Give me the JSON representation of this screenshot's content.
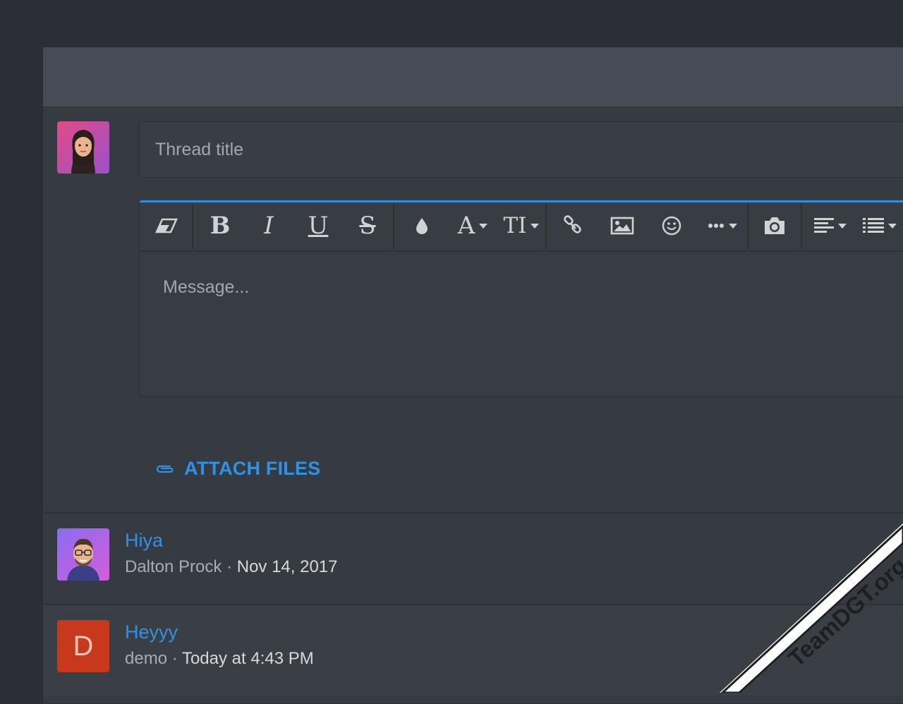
{
  "compose": {
    "title_placeholder": "Thread title",
    "message_placeholder": "Message...",
    "attach_label": "ATTACH FILES"
  },
  "toolbar": {
    "buttons": [
      {
        "name": "remove-formatting",
        "icon": "eraser-icon"
      },
      {
        "name": "bold",
        "glyph": "B"
      },
      {
        "name": "italic",
        "glyph": "I"
      },
      {
        "name": "underline",
        "glyph": "U"
      },
      {
        "name": "strikethrough",
        "glyph": "S"
      },
      {
        "name": "text-color",
        "icon": "droplet-icon"
      },
      {
        "name": "font-family",
        "glyph": "A"
      },
      {
        "name": "font-size",
        "glyph": "TI"
      },
      {
        "name": "insert-link",
        "icon": "link-icon"
      },
      {
        "name": "insert-image",
        "icon": "image-icon"
      },
      {
        "name": "smilies",
        "icon": "smiley-icon"
      },
      {
        "name": "more-options",
        "icon": "ellipsis-icon"
      },
      {
        "name": "insert-media",
        "icon": "camera-icon"
      },
      {
        "name": "alignment",
        "icon": "align-left-icon"
      },
      {
        "name": "list",
        "icon": "list-icon"
      }
    ]
  },
  "threads": [
    {
      "title": "Hiya",
      "author": "Dalton Prock",
      "separator": "·",
      "date": "Nov 14, 2017"
    },
    {
      "title": "Heyyy",
      "author": "demo",
      "separator": "·",
      "date": "Today at 4:43 PM",
      "avatar_letter": "D"
    }
  ],
  "colors": {
    "accent": "#2f92e6",
    "background": "#2b2f35",
    "panel": "#363a41",
    "header": "#474b55",
    "letter_avatar": "#c8381c"
  },
  "watermark": "TeamDGT.org"
}
